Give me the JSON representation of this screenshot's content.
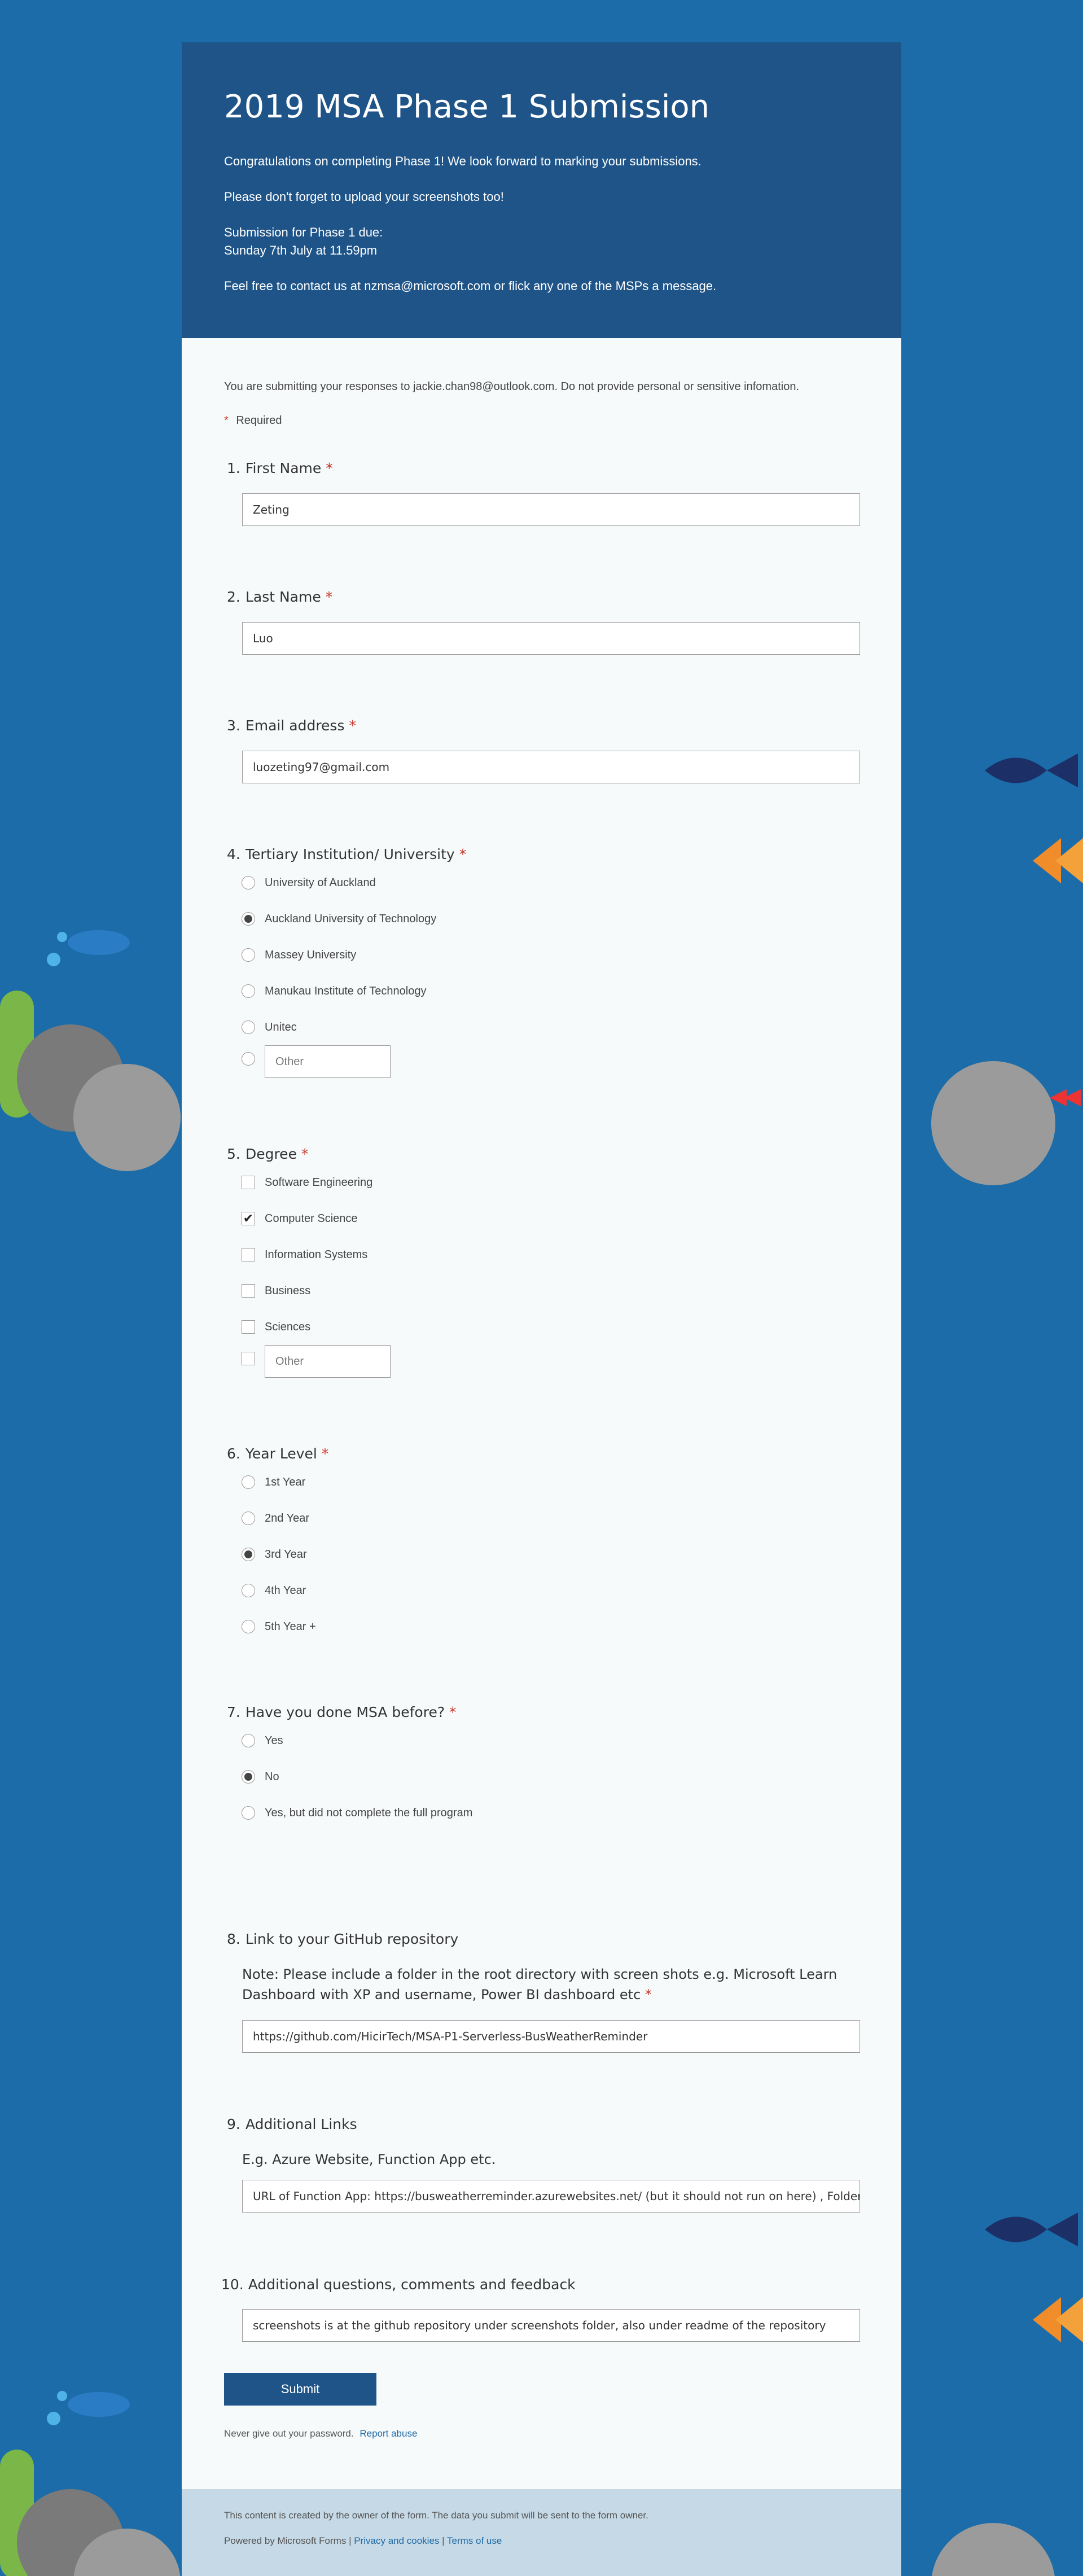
{
  "header": {
    "title": "2019 MSA Phase 1 Submission",
    "line1": "Congratulations on completing Phase 1! We look forward to marking your submissions.",
    "line2": "Please don't forget to upload your screenshots too!",
    "line3a": "Submission for Phase 1 due:",
    "line3b": "Sunday 7th July at 11.59pm",
    "line4": "Feel free to contact us at nzmsa@microsoft.com or flick any one of the MSPs a message."
  },
  "notice": "You are submitting your responses to jackie.chan98@outlook.com. Do not provide personal or sensitive infomation.",
  "required_label": "Required",
  "required_star": "*",
  "questions": {
    "q1": {
      "num": "1.",
      "title": "First Name",
      "value": "Zeting"
    },
    "q2": {
      "num": "2.",
      "title": "Last Name",
      "value": "Luo"
    },
    "q3": {
      "num": "3.",
      "title": "Email address",
      "value": "luozeting97@gmail.com"
    },
    "q4": {
      "num": "4.",
      "title": "Tertiary Institution/ University",
      "options": [
        "University of Auckland",
        "Auckland University of Technology",
        "Massey University",
        "Manukau Institute of Technology",
        "Unitec"
      ],
      "selected": "Auckland University of Technology",
      "other_placeholder": "Other"
    },
    "q5": {
      "num": "5.",
      "title": "Degree",
      "options": [
        "Software Engineering",
        "Computer Science",
        "Information Systems",
        "Business",
        "Sciences"
      ],
      "checked": [
        "Computer Science"
      ],
      "other_placeholder": "Other"
    },
    "q6": {
      "num": "6.",
      "title": "Year Level",
      "options": [
        "1st Year",
        "2nd Year",
        "3rd Year",
        "4th Year",
        "5th Year +"
      ],
      "selected": "3rd Year"
    },
    "q7": {
      "num": "7.",
      "title": "Have you done MSA before?",
      "options": [
        "Yes",
        "No",
        "Yes, but did not complete the full program"
      ],
      "selected": "No"
    },
    "q8": {
      "num": "8.",
      "title": "Link to your GitHub repository",
      "subtitle": "Note: Please include a folder in the root directory with screen shots e.g. Microsoft Learn Dashboard with XP and username, Power BI dashboard etc",
      "value": "https://github.com/HicirTech/MSA-P1-Serverless-BusWeatherReminder"
    },
    "q9": {
      "num": "9.",
      "title": "Additional Links",
      "subtitle": "E.g. Azure Website, Function App etc.",
      "value": "URL of Function App: https://busweatherreminder.azurewebsites.net/   (but it should not run on here) , Folder of screenshots"
    },
    "q10": {
      "num": "10.",
      "title": "Additional questions, comments and feedback",
      "value": "screenshots is at the github repository under screenshots folder, also under readme of the repository"
    }
  },
  "submit_label": "Submit",
  "password_note": "Never give out your password.",
  "report_abuse": "Report abuse",
  "footer": {
    "line1": "This content is created by the owner of the form. The data you submit will be sent to the form owner.",
    "powered": "Powered by Microsoft Forms",
    "sep": "|",
    "privacy": "Privacy and cookies",
    "terms": "Terms of use"
  },
  "colors": {
    "background": "#1b6ca8",
    "header": "#1f5488",
    "required": "#c7392b"
  }
}
